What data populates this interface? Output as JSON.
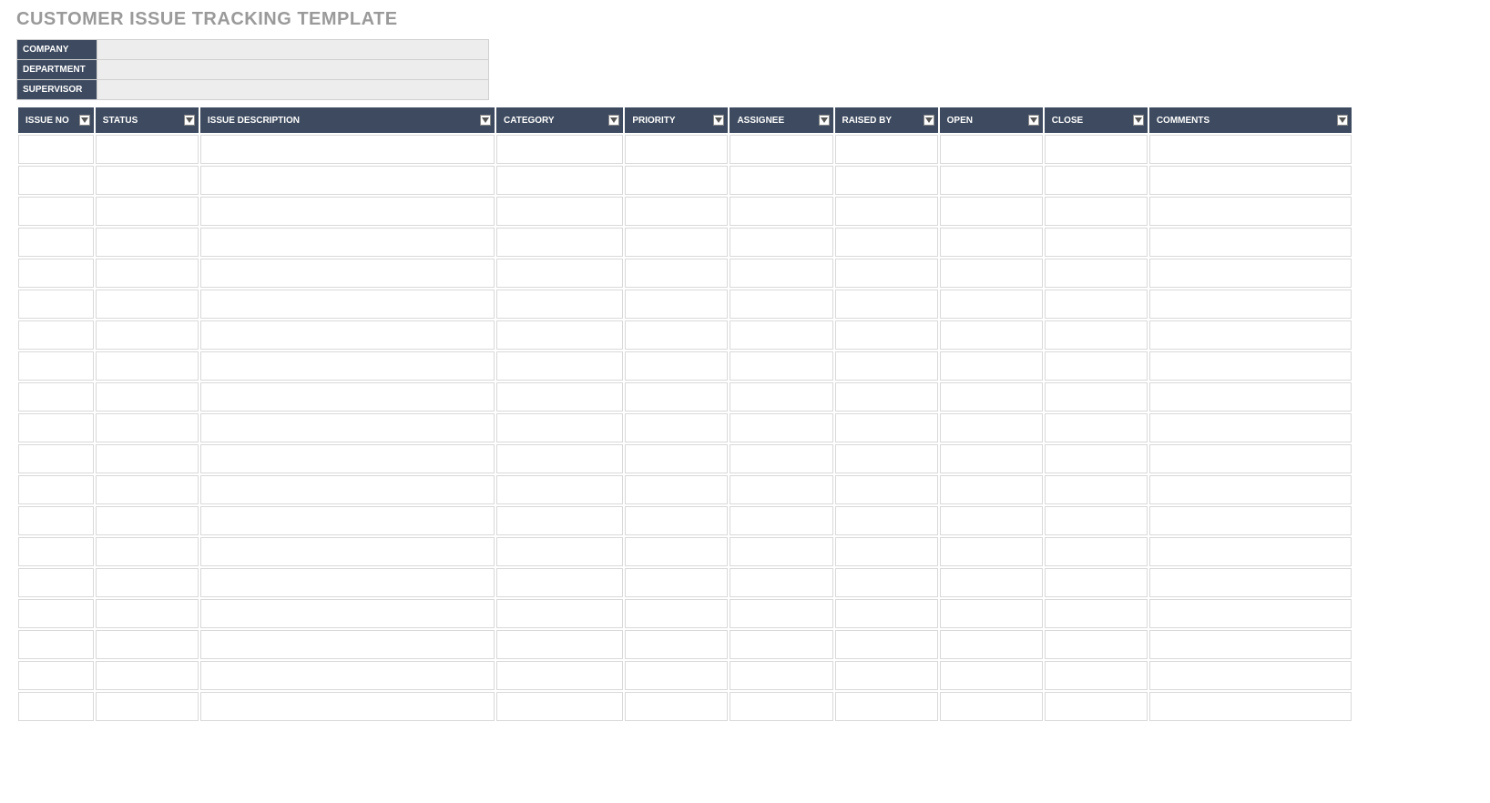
{
  "title": "CUSTOMER ISSUE TRACKING TEMPLATE",
  "meta": {
    "company_label": "COMPANY",
    "company_value": "",
    "department_label": "DEPARTMENT",
    "department_value": "",
    "supervisor_label": "SUPERVISOR",
    "supervisor_value": ""
  },
  "columns": [
    {
      "key": "issue_no",
      "label": "ISSUE NO"
    },
    {
      "key": "status",
      "label": "STATUS"
    },
    {
      "key": "description",
      "label": "ISSUE DESCRIPTION"
    },
    {
      "key": "category",
      "label": "CATEGORY"
    },
    {
      "key": "priority",
      "label": "PRIORITY"
    },
    {
      "key": "assignee",
      "label": "ASSIGNEE"
    },
    {
      "key": "raised_by",
      "label": "RAISED BY"
    },
    {
      "key": "open",
      "label": "OPEN"
    },
    {
      "key": "close",
      "label": "CLOSE"
    },
    {
      "key": "comments",
      "label": "COMMENTS"
    }
  ],
  "row_count": 19,
  "colors": {
    "header_bg": "#3d4a5f",
    "title_color": "#9a9a9a",
    "meta_value_bg": "#ededed",
    "cell_border": "#d9d9d9"
  }
}
